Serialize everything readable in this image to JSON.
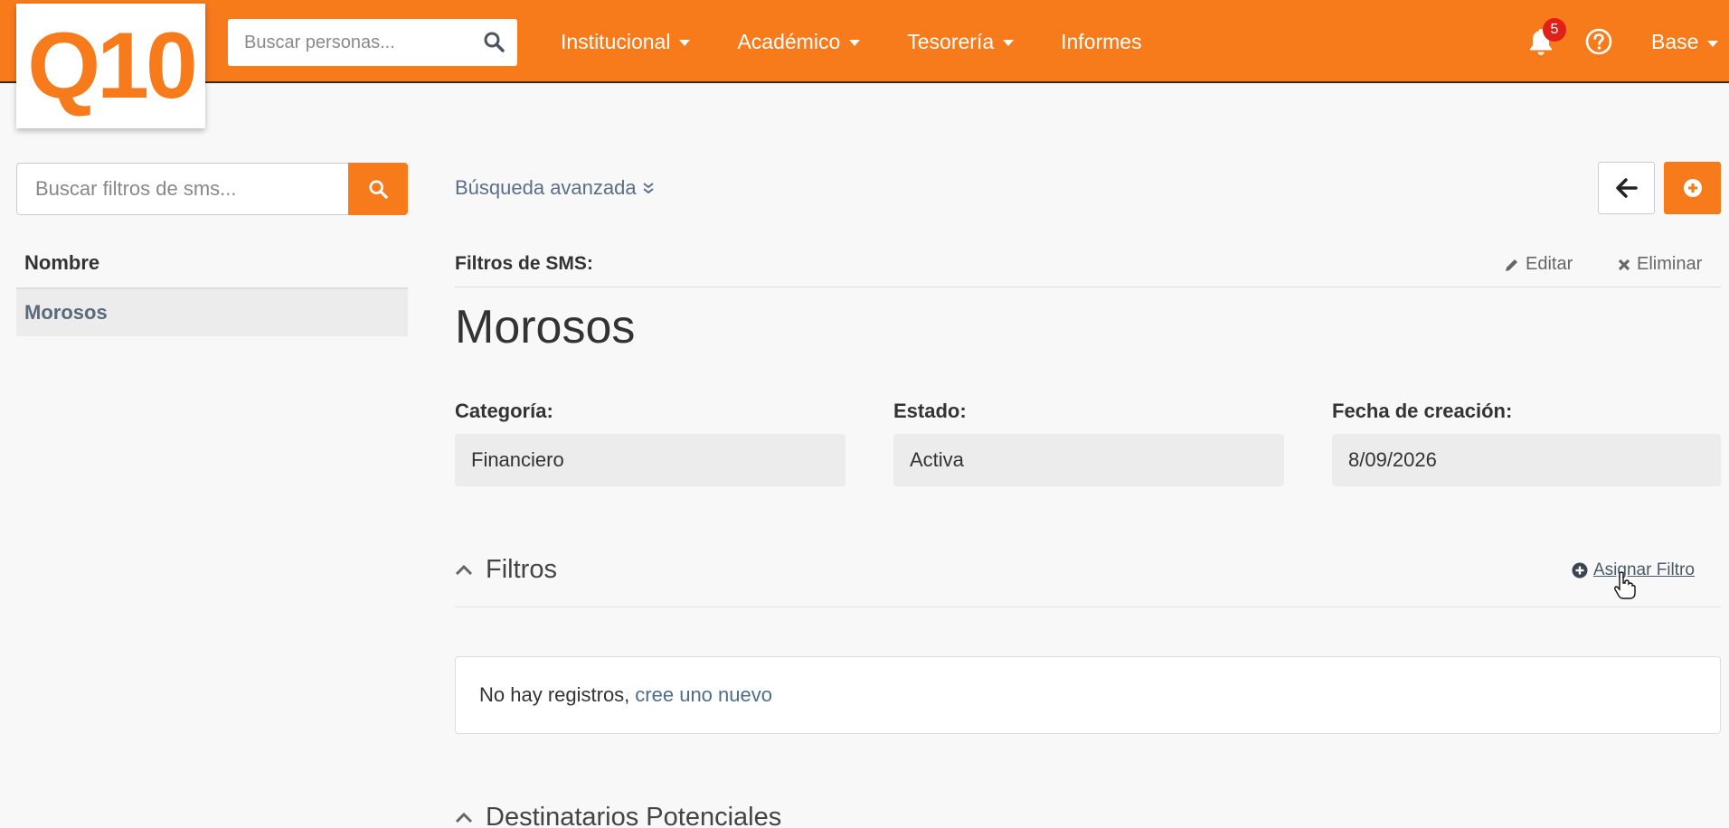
{
  "logo": {
    "text": "Q10"
  },
  "topbar": {
    "search_placeholder": "Buscar personas...",
    "nav": [
      {
        "label": "Institucional",
        "has_caret": true
      },
      {
        "label": "Académico",
        "has_caret": true
      },
      {
        "label": "Tesorería",
        "has_caret": true
      },
      {
        "label": "Informes",
        "has_caret": false
      }
    ],
    "notifications_count": "5",
    "user_label": "Base"
  },
  "sidebar": {
    "search_placeholder": "Buscar filtros de sms...",
    "column_header": "Nombre",
    "items": [
      {
        "label": "Morosos",
        "selected": true
      }
    ]
  },
  "main": {
    "advanced_search": "Búsqueda avanzada",
    "section_label": "Filtros de SMS:",
    "edit_label": "Editar",
    "delete_label": "Eliminar",
    "title": "Morosos",
    "fields": [
      {
        "label": "Categoría:",
        "value": "Financiero"
      },
      {
        "label": "Estado:",
        "value": "Activa"
      },
      {
        "label": "Fecha de creación:",
        "value": "8/09/2026"
      }
    ],
    "filters_section": {
      "title": "Filtros",
      "assign_label": "Asignar Filtro",
      "empty_text": "No hay registros,",
      "empty_link": "cree uno nuevo"
    },
    "recipients_section": {
      "title": "Destinatarios Potenciales"
    }
  },
  "colors": {
    "brand": "#f77a1b",
    "badge": "#e0211a",
    "link": "#4c6e8c"
  }
}
